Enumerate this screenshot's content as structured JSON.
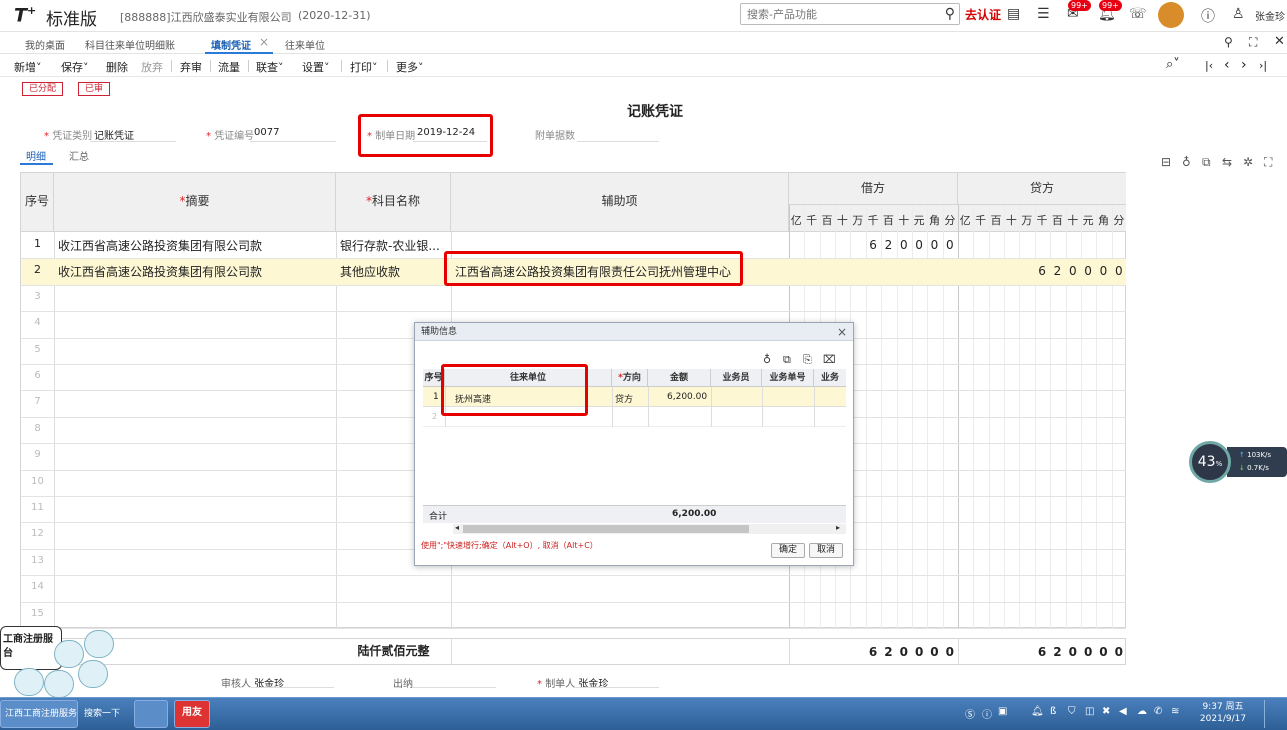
{
  "header": {
    "logo": "T",
    "logo_sup": "+",
    "edition": "标准版",
    "company": "[888888]江西欣盛泰实业有限公司",
    "period": "(2020-12-31)",
    "search_placeholder": "搜索-产品功能",
    "brand_mark": "去认证",
    "notif_badge_1": "99+",
    "notif_badge_2": "99+",
    "user": "张金珍"
  },
  "tabs": [
    {
      "label": "我的桌面"
    },
    {
      "label": "科目往来单位明细账"
    },
    {
      "label": "填制凭证",
      "close": "×"
    },
    {
      "label": "往来单位"
    }
  ],
  "toolbar": {
    "new": "新增˅",
    "save": "保存˅",
    "delete": "删除",
    "discard": "放弃",
    "cancel_review": "弃审",
    "cashflow": "流量",
    "query": "联查˅",
    "settings": "设置˅",
    "print": "打印˅",
    "more": "更多˅",
    "nav_first": "|‹",
    "nav_prev": "‹",
    "nav_next": "›",
    "nav_last": "›|"
  },
  "stamps": {
    "allocated": "已分配",
    "reviewed": "已审"
  },
  "voucher": {
    "title": "记账凭证",
    "type_label": "凭证类别",
    "type_value": "记账凭证",
    "number_label": "凭证编号",
    "number_value": "0077",
    "date_label": "制单日期",
    "date_value": "2019-12-24",
    "attachments_label": "附单据数",
    "required_mark": "*"
  },
  "subtabs": {
    "detail": "明细",
    "summary": "汇总"
  },
  "grid": {
    "headers": {
      "seq": "序号",
      "summary": "摘要",
      "account": "科目名称",
      "aux": "辅助项",
      "debit": "借方",
      "credit": "贷方"
    },
    "digit_units": [
      "亿",
      "千",
      "百",
      "十",
      "万",
      "千",
      "百",
      "十",
      "元",
      "角",
      "分"
    ],
    "rows": [
      {
        "seq": "1",
        "summary": "收江西省高速公路投资集团有限公司款",
        "account": "银行存款-农业银...",
        "aux": "",
        "debit_digits": [
          "6",
          "2",
          "0",
          "0",
          "0",
          "0"
        ],
        "credit_digits": []
      },
      {
        "seq": "2",
        "summary": "收江西省高速公路投资集团有限公司款",
        "account": "其他应收款",
        "aux": "江西省高速公路投资集团有限责任公司抚州管理中心",
        "debit_digits": [],
        "credit_digits": [
          "6",
          "2",
          "0",
          "0",
          "0",
          "0"
        ]
      }
    ],
    "empty_rows": [
      "3",
      "4",
      "5",
      "6",
      "7",
      "8",
      "9",
      "10",
      "11",
      "12",
      "13",
      "14",
      "15"
    ]
  },
  "totals": {
    "amount_in_words": "陆仟贰佰元整",
    "debit_digits": [
      "6",
      "2",
      "0",
      "0",
      "0",
      "0"
    ],
    "credit_digits": [
      "6",
      "2",
      "0",
      "0",
      "0",
      "0"
    ]
  },
  "signatures": {
    "reviewer_label": "审核人",
    "reviewer": "张金珍",
    "cashier_label": "出纳",
    "maker_label": "制单人",
    "maker": "张金珍"
  },
  "dialog": {
    "title": "辅助信息",
    "close": "×",
    "columns": [
      "序号",
      "往来单位",
      "方向",
      "金额",
      "业务员",
      "业务单号",
      "业务"
    ],
    "rows": [
      {
        "seq": "1",
        "unit": "抚州高速",
        "direction": "贷方",
        "amount": "6,200.00",
        "salesman": "",
        "doc_no": ""
      }
    ],
    "empty_row_seq": "2",
    "total_label": "合计",
    "total_amount": "6,200.00",
    "hint": "使用\";\"快速增行;确定（Alt+O）, 取消（Alt+C）",
    "ok": "确定",
    "cancel": "取消"
  },
  "speed_widget": {
    "percent": "43",
    "percent_unit": "%",
    "up": "103K/s",
    "down": "0.7K/s"
  },
  "mascot": {
    "bubble_line1": "工商注册服",
    "bubble_line2": "台"
  },
  "taskbar": {
    "app1": "江西工商注册服务...",
    "app2": "搜索一下",
    "app4": "用友",
    "time": "9:37 周五",
    "date": "2021/9/17"
  },
  "colors": {
    "accent": "#2a7ad9",
    "highlight_row": "#fdf7d3",
    "callout": "#e60000"
  }
}
